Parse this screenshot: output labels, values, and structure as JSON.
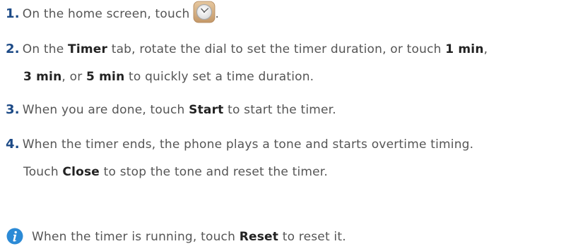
{
  "steps": [
    {
      "num": "1.",
      "t1": "On the home screen, touch",
      "t2": ".",
      "icon": "clock-app-icon"
    },
    {
      "num": "2.",
      "t1": "On the ",
      "b1": "Timer",
      "t2": " tab, rotate the dial to set the timer duration, or touch ",
      "b2": "1 min",
      "t3": ",",
      "b3": "3 min",
      "t4": ", or ",
      "b4": "5 min",
      "t5": " to quickly set a time duration."
    },
    {
      "num": "3.",
      "t1": "When you are done, touch ",
      "b1": "Start",
      "t2": " to start the timer."
    },
    {
      "num": "4.",
      "t1": "When the timer ends, the phone plays a tone and starts overtime timing.",
      "t2": "Touch ",
      "b1": "Close",
      "t3": " to stop the tone and reset the timer."
    }
  ],
  "note": {
    "icon": "info-icon",
    "t1": "When the timer is running, touch ",
    "b1": "Reset",
    "t2": " to reset it."
  },
  "colors": {
    "step_number": "#1c4a86",
    "body_text": "#555555",
    "bold_text": "#222222",
    "info_icon": "#2b8ad6"
  }
}
